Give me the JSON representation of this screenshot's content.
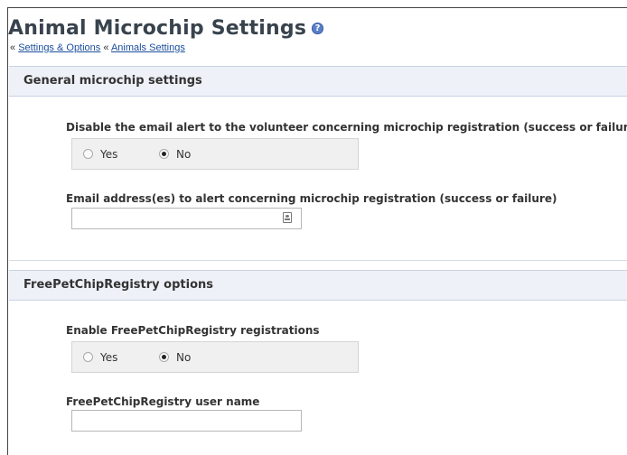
{
  "page": {
    "title": "Animal Microchip Settings",
    "breadcrumb": {
      "sep1": "«",
      "link1": "Settings & Options",
      "sep2": "«",
      "link2": "Animals Settings"
    }
  },
  "sections": [
    {
      "heading": "General microchip settings",
      "fields": [
        {
          "label": "Disable the email alert to the volunteer concerning microchip registration (success or failure)",
          "type": "radio",
          "options": [
            "Yes",
            "No"
          ],
          "selected": "No"
        },
        {
          "label": "Email address(es) to alert concerning microchip registration (success or failure)",
          "type": "text",
          "value": ""
        }
      ]
    },
    {
      "heading": "FreePetChipRegistry options",
      "fields": [
        {
          "label": "Enable FreePetChipRegistry registrations",
          "type": "radio",
          "options": [
            "Yes",
            "No"
          ],
          "selected": "No"
        },
        {
          "label": "FreePetChipRegistry user name",
          "type": "text",
          "value": ""
        }
      ]
    }
  ],
  "icons": {
    "help": "help-circle-icon",
    "contact": "contact-card-icon"
  },
  "colors": {
    "title": "#39434d",
    "link": "#1a4e9c",
    "section_bg": "#eef1f7",
    "help_icon": "#5b7fc7"
  }
}
